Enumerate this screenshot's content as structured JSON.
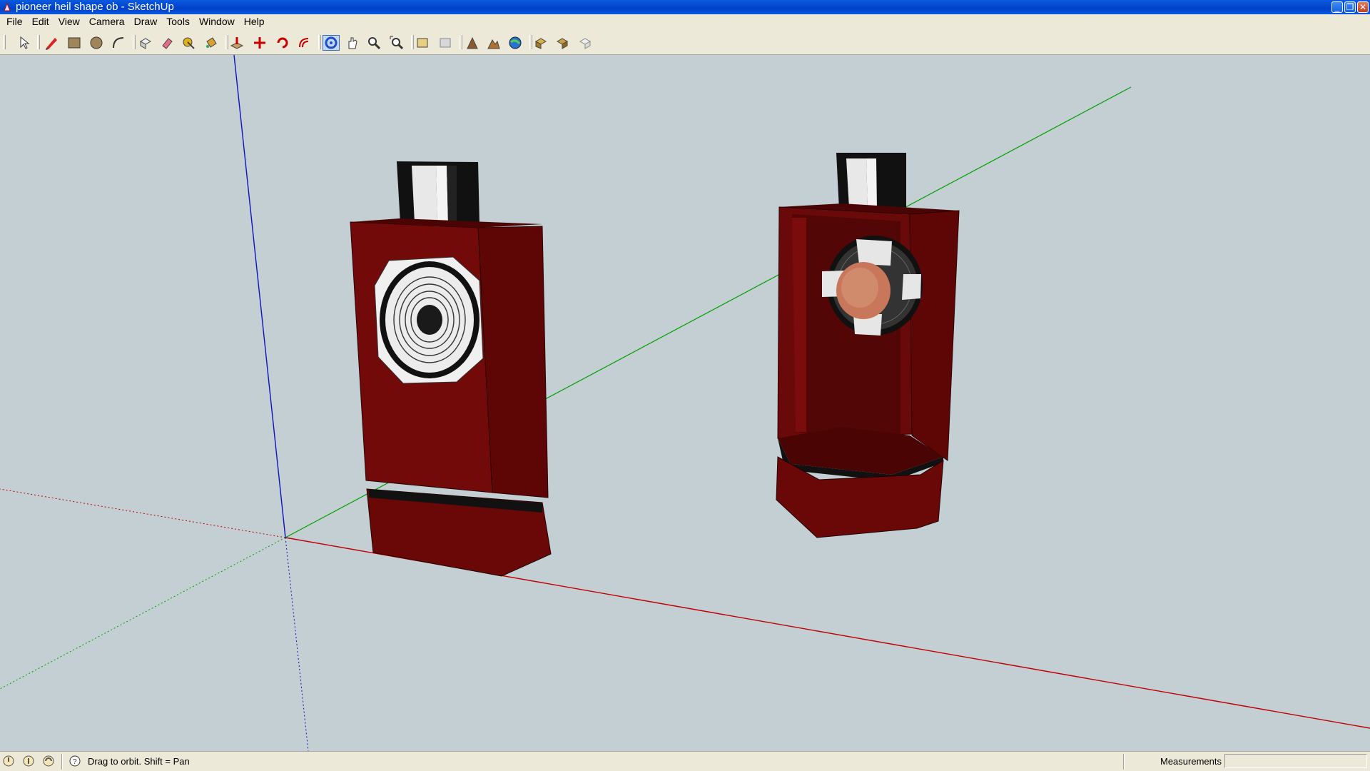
{
  "window": {
    "title": "pioneer heil shape ob - SketchUp"
  },
  "menu": [
    "File",
    "Edit",
    "View",
    "Camera",
    "Draw",
    "Tools",
    "Window",
    "Help"
  ],
  "toolbar": {
    "tools": [
      "select-icon",
      "pencil-icon",
      "rectangle-icon",
      "circle-icon",
      "arc-icon",
      "make-component-icon",
      "eraser-icon",
      "tape-measure-icon",
      "paint-bucket-icon",
      "push-pull-icon",
      "move-icon",
      "rotate-icon",
      "offset-icon",
      "orbit-icon",
      "pan-icon",
      "zoom-icon",
      "zoom-extents-icon",
      "previous-view-icon",
      "next-view-icon",
      "add-location-icon",
      "toggle-terrain-icon",
      "google-earth-icon",
      "get-models-icon",
      "share-model-icon",
      "make-texture-icon"
    ],
    "active": "orbit-icon"
  },
  "status": {
    "hint": "Drag to orbit.  Shift = Pan",
    "measurements_label": "Measurements",
    "measurements_value": ""
  },
  "colors": {
    "background": "#c3cfd3",
    "wood": "#6e0a0a",
    "red_axis": "#c00000",
    "green_axis": "#00a000",
    "blue_axis": "#1010c0"
  }
}
